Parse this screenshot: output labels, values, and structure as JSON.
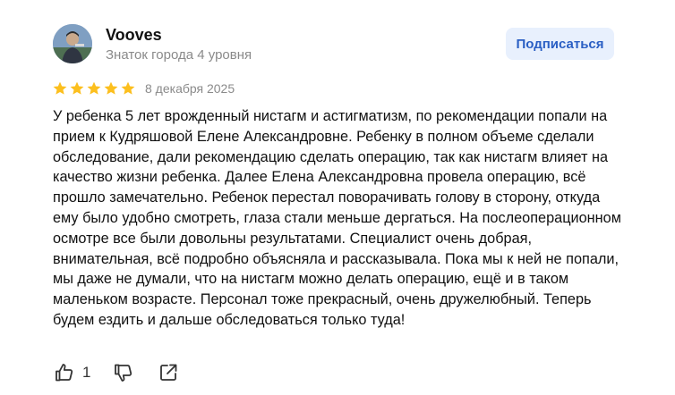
{
  "author": {
    "name": "Vooves",
    "level": "Знаток города 4 уровня"
  },
  "subscribe_button": {
    "label": "Подписаться"
  },
  "review": {
    "rating": 5,
    "rating_max": 5,
    "date": "8 декабря 2025",
    "text": "У ребенка 5 лет врожденный нистагм и астигматизм, по рекомендации попали на прием к Кудряшовой Елене Александровне. Ребенку в полном объеме сделали обследование, дали рекомендацию сделать операцию, так как нистагм влияет на качество жизни ребенка. Далее Елена Александровна провела операцию, всё прошло замечательно. Ребенок перестал поворачивать голову в сторону, откуда ему было удобно смотреть, глаза стали меньше дергаться. На послеоперационном осмотре все были довольны результатами. Специалист очень добрая, внимательная, всё подробно объясняла и рассказывала. Пока мы к ней не попали, мы даже не думали, что на нистагм можно делать операцию, ещё и в таком маленьком возрасте. Персонал тоже прекрасный, очень дружелюбный. Теперь будем ездить и дальше обследоваться только туда!"
  },
  "actions": {
    "like_count": "1",
    "icons": [
      "thumbs-up-icon",
      "thumbs-down-icon",
      "share-icon"
    ]
  },
  "colors": {
    "star": "#fcbf1e",
    "subscribe_bg": "#e8f0fd",
    "subscribe_text": "#2a5fc4",
    "muted_text": "#8a8a8a"
  }
}
